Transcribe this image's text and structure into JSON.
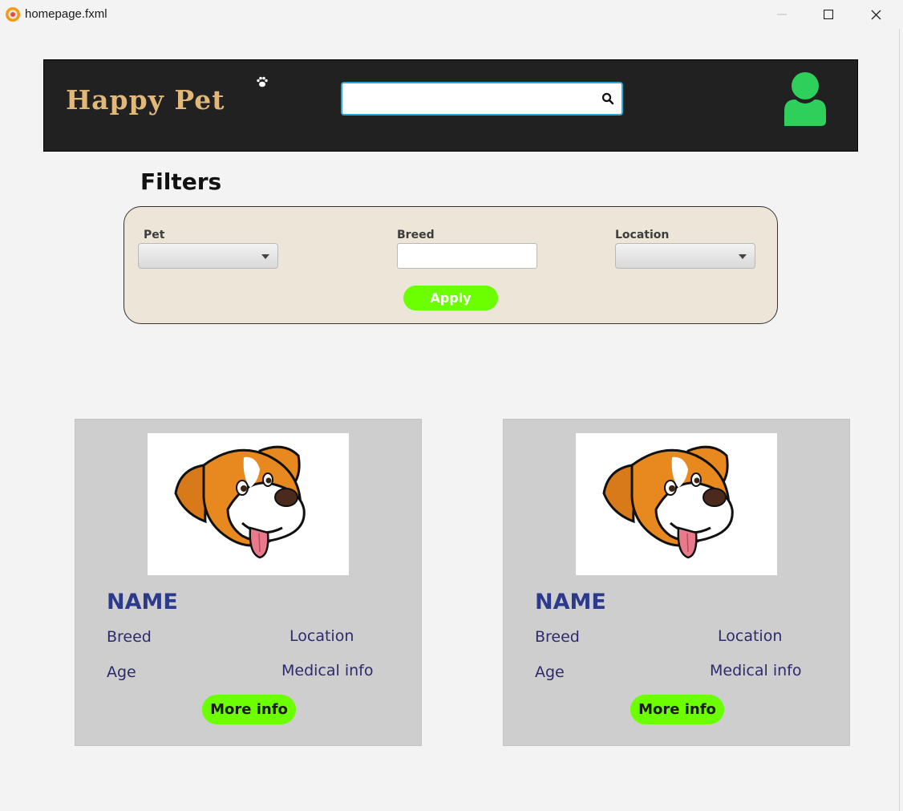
{
  "window": {
    "title": "homepage.fxml"
  },
  "header": {
    "brand": "Happy Pet",
    "brand_color": "#e2b879",
    "search_value": "",
    "user_icon_color": "#2fcf5b"
  },
  "filters": {
    "title": "Filters",
    "pet_label": "Pet",
    "breed_label": "Breed",
    "location_label": "Location",
    "apply_label": "Apply"
  },
  "cards": [
    {
      "name": "NAME",
      "breed": "Breed",
      "location": "Location",
      "age": "Age",
      "medical": "Medical info",
      "button": "More info"
    },
    {
      "name": "NAME",
      "breed": "Breed",
      "location": "Location",
      "age": "Age",
      "medical": "Medical info",
      "button": "More info"
    }
  ],
  "colors": {
    "accent_green": "#6bff00",
    "header_bg": "#212121",
    "name_blue": "#2b3a8b"
  }
}
